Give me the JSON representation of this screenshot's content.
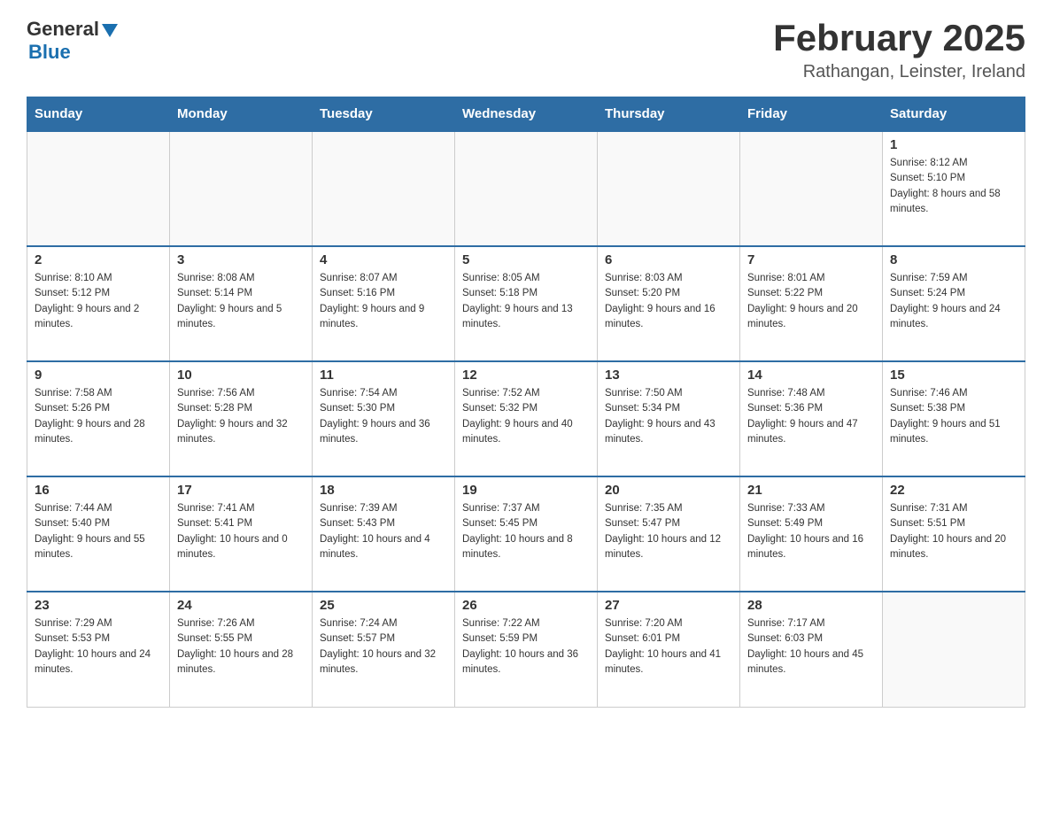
{
  "header": {
    "logo_general": "General",
    "logo_blue": "Blue",
    "month_title": "February 2025",
    "location": "Rathangan, Leinster, Ireland"
  },
  "days_of_week": [
    "Sunday",
    "Monday",
    "Tuesday",
    "Wednesday",
    "Thursday",
    "Friday",
    "Saturday"
  ],
  "weeks": [
    {
      "days": [
        {
          "number": "",
          "sunrise": "",
          "sunset": "",
          "daylight": "",
          "empty": true
        },
        {
          "number": "",
          "sunrise": "",
          "sunset": "",
          "daylight": "",
          "empty": true
        },
        {
          "number": "",
          "sunrise": "",
          "sunset": "",
          "daylight": "",
          "empty": true
        },
        {
          "number": "",
          "sunrise": "",
          "sunset": "",
          "daylight": "",
          "empty": true
        },
        {
          "number": "",
          "sunrise": "",
          "sunset": "",
          "daylight": "",
          "empty": true
        },
        {
          "number": "",
          "sunrise": "",
          "sunset": "",
          "daylight": "",
          "empty": true
        },
        {
          "number": "1",
          "sunrise": "Sunrise: 8:12 AM",
          "sunset": "Sunset: 5:10 PM",
          "daylight": "Daylight: 8 hours and 58 minutes.",
          "empty": false
        }
      ]
    },
    {
      "days": [
        {
          "number": "2",
          "sunrise": "Sunrise: 8:10 AM",
          "sunset": "Sunset: 5:12 PM",
          "daylight": "Daylight: 9 hours and 2 minutes.",
          "empty": false
        },
        {
          "number": "3",
          "sunrise": "Sunrise: 8:08 AM",
          "sunset": "Sunset: 5:14 PM",
          "daylight": "Daylight: 9 hours and 5 minutes.",
          "empty": false
        },
        {
          "number": "4",
          "sunrise": "Sunrise: 8:07 AM",
          "sunset": "Sunset: 5:16 PM",
          "daylight": "Daylight: 9 hours and 9 minutes.",
          "empty": false
        },
        {
          "number": "5",
          "sunrise": "Sunrise: 8:05 AM",
          "sunset": "Sunset: 5:18 PM",
          "daylight": "Daylight: 9 hours and 13 minutes.",
          "empty": false
        },
        {
          "number": "6",
          "sunrise": "Sunrise: 8:03 AM",
          "sunset": "Sunset: 5:20 PM",
          "daylight": "Daylight: 9 hours and 16 minutes.",
          "empty": false
        },
        {
          "number": "7",
          "sunrise": "Sunrise: 8:01 AM",
          "sunset": "Sunset: 5:22 PM",
          "daylight": "Daylight: 9 hours and 20 minutes.",
          "empty": false
        },
        {
          "number": "8",
          "sunrise": "Sunrise: 7:59 AM",
          "sunset": "Sunset: 5:24 PM",
          "daylight": "Daylight: 9 hours and 24 minutes.",
          "empty": false
        }
      ]
    },
    {
      "days": [
        {
          "number": "9",
          "sunrise": "Sunrise: 7:58 AM",
          "sunset": "Sunset: 5:26 PM",
          "daylight": "Daylight: 9 hours and 28 minutes.",
          "empty": false
        },
        {
          "number": "10",
          "sunrise": "Sunrise: 7:56 AM",
          "sunset": "Sunset: 5:28 PM",
          "daylight": "Daylight: 9 hours and 32 minutes.",
          "empty": false
        },
        {
          "number": "11",
          "sunrise": "Sunrise: 7:54 AM",
          "sunset": "Sunset: 5:30 PM",
          "daylight": "Daylight: 9 hours and 36 minutes.",
          "empty": false
        },
        {
          "number": "12",
          "sunrise": "Sunrise: 7:52 AM",
          "sunset": "Sunset: 5:32 PM",
          "daylight": "Daylight: 9 hours and 40 minutes.",
          "empty": false
        },
        {
          "number": "13",
          "sunrise": "Sunrise: 7:50 AM",
          "sunset": "Sunset: 5:34 PM",
          "daylight": "Daylight: 9 hours and 43 minutes.",
          "empty": false
        },
        {
          "number": "14",
          "sunrise": "Sunrise: 7:48 AM",
          "sunset": "Sunset: 5:36 PM",
          "daylight": "Daylight: 9 hours and 47 minutes.",
          "empty": false
        },
        {
          "number": "15",
          "sunrise": "Sunrise: 7:46 AM",
          "sunset": "Sunset: 5:38 PM",
          "daylight": "Daylight: 9 hours and 51 minutes.",
          "empty": false
        }
      ]
    },
    {
      "days": [
        {
          "number": "16",
          "sunrise": "Sunrise: 7:44 AM",
          "sunset": "Sunset: 5:40 PM",
          "daylight": "Daylight: 9 hours and 55 minutes.",
          "empty": false
        },
        {
          "number": "17",
          "sunrise": "Sunrise: 7:41 AM",
          "sunset": "Sunset: 5:41 PM",
          "daylight": "Daylight: 10 hours and 0 minutes.",
          "empty": false
        },
        {
          "number": "18",
          "sunrise": "Sunrise: 7:39 AM",
          "sunset": "Sunset: 5:43 PM",
          "daylight": "Daylight: 10 hours and 4 minutes.",
          "empty": false
        },
        {
          "number": "19",
          "sunrise": "Sunrise: 7:37 AM",
          "sunset": "Sunset: 5:45 PM",
          "daylight": "Daylight: 10 hours and 8 minutes.",
          "empty": false
        },
        {
          "number": "20",
          "sunrise": "Sunrise: 7:35 AM",
          "sunset": "Sunset: 5:47 PM",
          "daylight": "Daylight: 10 hours and 12 minutes.",
          "empty": false
        },
        {
          "number": "21",
          "sunrise": "Sunrise: 7:33 AM",
          "sunset": "Sunset: 5:49 PM",
          "daylight": "Daylight: 10 hours and 16 minutes.",
          "empty": false
        },
        {
          "number": "22",
          "sunrise": "Sunrise: 7:31 AM",
          "sunset": "Sunset: 5:51 PM",
          "daylight": "Daylight: 10 hours and 20 minutes.",
          "empty": false
        }
      ]
    },
    {
      "days": [
        {
          "number": "23",
          "sunrise": "Sunrise: 7:29 AM",
          "sunset": "Sunset: 5:53 PM",
          "daylight": "Daylight: 10 hours and 24 minutes.",
          "empty": false
        },
        {
          "number": "24",
          "sunrise": "Sunrise: 7:26 AM",
          "sunset": "Sunset: 5:55 PM",
          "daylight": "Daylight: 10 hours and 28 minutes.",
          "empty": false
        },
        {
          "number": "25",
          "sunrise": "Sunrise: 7:24 AM",
          "sunset": "Sunset: 5:57 PM",
          "daylight": "Daylight: 10 hours and 32 minutes.",
          "empty": false
        },
        {
          "number": "26",
          "sunrise": "Sunrise: 7:22 AM",
          "sunset": "Sunset: 5:59 PM",
          "daylight": "Daylight: 10 hours and 36 minutes.",
          "empty": false
        },
        {
          "number": "27",
          "sunrise": "Sunrise: 7:20 AM",
          "sunset": "Sunset: 6:01 PM",
          "daylight": "Daylight: 10 hours and 41 minutes.",
          "empty": false
        },
        {
          "number": "28",
          "sunrise": "Sunrise: 7:17 AM",
          "sunset": "Sunset: 6:03 PM",
          "daylight": "Daylight: 10 hours and 45 minutes.",
          "empty": false
        },
        {
          "number": "",
          "sunrise": "",
          "sunset": "",
          "daylight": "",
          "empty": true
        }
      ]
    }
  ]
}
